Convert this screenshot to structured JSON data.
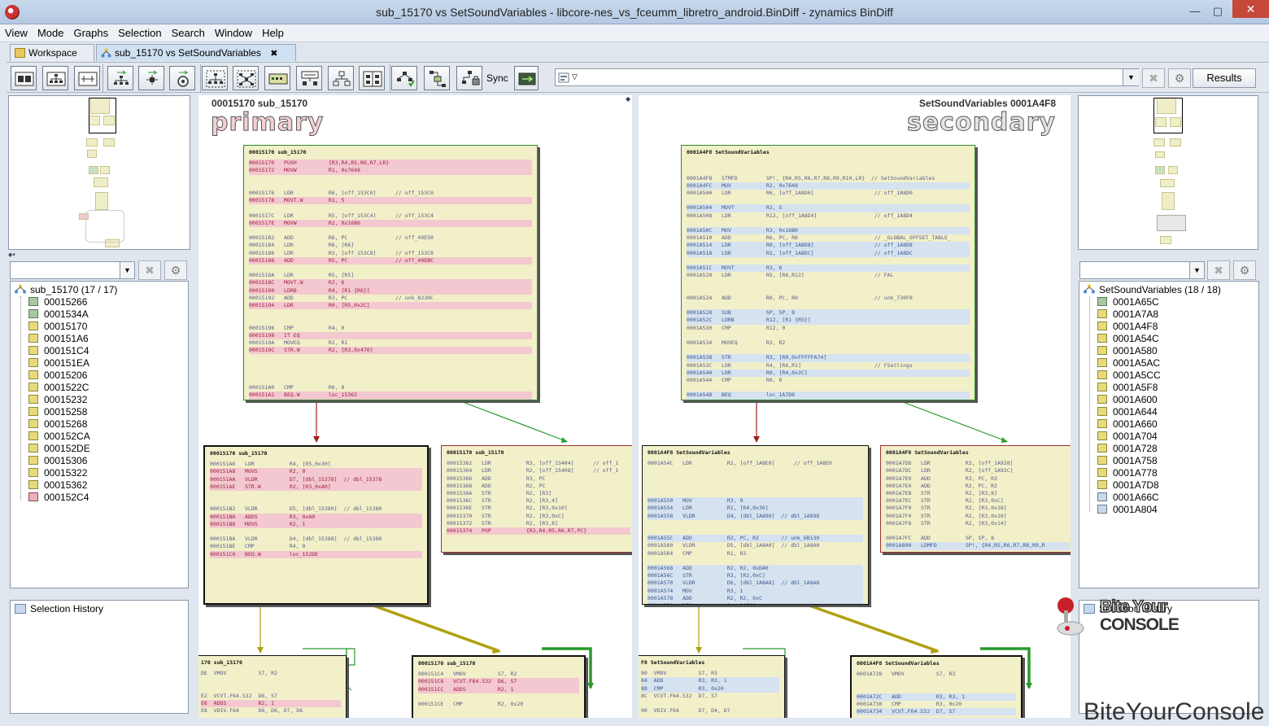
{
  "window": {
    "title": "sub_15170 vs SetSoundVariables - libcore-nes_vs_fceumm_libretro_android.BinDiff - zynamics BinDiff",
    "minimize": "—",
    "maximize": "▢",
    "close": "✕"
  },
  "menu": [
    "View",
    "Mode",
    "Graphs",
    "Selection",
    "Search",
    "Window",
    "Help"
  ],
  "tabs": [
    {
      "label": "Workspace"
    },
    {
      "label": "sub_15170 vs SetSoundVariables",
      "close": "✖"
    }
  ],
  "toolbar": {
    "sync_label": "Sync",
    "results_label": "Results"
  },
  "primary": {
    "header": "00015170  sub_15170",
    "label": "primary",
    "tree_root": "sub_15170 (17 / 17)",
    "tree_items": [
      {
        "addr": "00015266",
        "kind": "g"
      },
      {
        "addr": "0001534A",
        "kind": "g"
      },
      {
        "addr": "00015170",
        "kind": "y"
      },
      {
        "addr": "000151A6",
        "kind": "y"
      },
      {
        "addr": "000151C4",
        "kind": "y"
      },
      {
        "addr": "000151EA",
        "kind": "y"
      },
      {
        "addr": "00015206",
        "kind": "y"
      },
      {
        "addr": "0001522C",
        "kind": "y"
      },
      {
        "addr": "00015232",
        "kind": "y"
      },
      {
        "addr": "00015258",
        "kind": "y"
      },
      {
        "addr": "00015268",
        "kind": "y"
      },
      {
        "addr": "000152CA",
        "kind": "y"
      },
      {
        "addr": "000152DE",
        "kind": "y"
      },
      {
        "addr": "00015306",
        "kind": "y"
      },
      {
        "addr": "00015322",
        "kind": "y"
      },
      {
        "addr": "00015362",
        "kind": "y"
      },
      {
        "addr": "000152C4",
        "kind": "r"
      }
    ],
    "history_title": "Selection History"
  },
  "secondary": {
    "header": "SetSoundVariables  0001A4F8",
    "label": "secondary",
    "tree_root": "SetSoundVariables (18 / 18)",
    "tree_items": [
      {
        "addr": "0001A65C",
        "kind": "g"
      },
      {
        "addr": "0001A7A8",
        "kind": "y"
      },
      {
        "addr": "0001A4F8",
        "kind": "y"
      },
      {
        "addr": "0001A54C",
        "kind": "y"
      },
      {
        "addr": "0001A580",
        "kind": "y"
      },
      {
        "addr": "0001A5AC",
        "kind": "y"
      },
      {
        "addr": "0001A5CC",
        "kind": "y"
      },
      {
        "addr": "0001A5F8",
        "kind": "y"
      },
      {
        "addr": "0001A600",
        "kind": "y"
      },
      {
        "addr": "0001A644",
        "kind": "y"
      },
      {
        "addr": "0001A660",
        "kind": "y"
      },
      {
        "addr": "0001A704",
        "kind": "y"
      },
      {
        "addr": "0001A728",
        "kind": "y"
      },
      {
        "addr": "0001A758",
        "kind": "y"
      },
      {
        "addr": "0001A778",
        "kind": "y"
      },
      {
        "addr": "0001A7D8",
        "kind": "y"
      },
      {
        "addr": "0001A66C",
        "kind": "b"
      },
      {
        "addr": "0001A804",
        "kind": "b"
      }
    ],
    "history_title": "Selection History"
  },
  "blocks": {
    "p1": {
      "head": "00015170    sub_15170",
      "lines": [
        [
          "pk",
          "00015170   PUSH          {R3,R4,R5,R6,R7,LR}"
        ],
        [
          "pk",
          "00015172   MOVW          R1, 0x7648"
        ],
        [
          "",
          ""
        ],
        [
          "",
          ""
        ],
        [
          "",
          "00015176   LDR           R6, [off_153C0]      // off_153C0"
        ],
        [
          "pk",
          "00015178   MOVT.W        R1, 5"
        ],
        [
          "",
          ""
        ],
        [
          "",
          "0001517C   LDR           R5, [off_153C4]      // off_153C4"
        ],
        [
          "pk",
          "0001517E   MOVW          R2, 0x16B0"
        ],
        [
          "",
          ""
        ],
        [
          "",
          "00015182   ADD           R6, PC               // off_49E50"
        ],
        [
          "",
          "00015184   LDR           R6, [R6]"
        ],
        [
          "",
          "00015186   LDR           R3, [off_153C8]      // off_153C8"
        ],
        [
          "pk",
          "00015188   ADD           R5, PC               // off_49EBC"
        ],
        [
          "",
          ""
        ],
        [
          "",
          "0001518A   LDR           R5, [R5]"
        ],
        [
          "pk",
          "0001518C   MOVT.W        R2, 6"
        ],
        [
          "pk",
          "00015190   LDRB          R4, [R1 {R6}]"
        ],
        [
          "",
          "00015192   ADD           R3, PC               // unk_8230C"
        ],
        [
          "pk",
          "00015194   LDR           R0, [R5,0x2C]"
        ],
        [
          "",
          ""
        ],
        [
          "",
          ""
        ],
        [
          "",
          "00015196   CMP           R4, 0"
        ],
        [
          "pk",
          "00015198   IT EQ"
        ],
        [
          "",
          "0001519A   MOVEQ         R2, R1"
        ],
        [
          "pk",
          "0001519C   STR.W         R2, [R3,0x470]"
        ],
        [
          "",
          ""
        ],
        [
          "",
          ""
        ],
        [
          "",
          ""
        ],
        [
          "",
          ""
        ],
        [
          "",
          "000151A0   CMP           R0, 0"
        ],
        [
          "pk",
          "000151A2   BEQ.W         loc_15362"
        ]
      ]
    },
    "p2": {
      "head": "00015170    sub_15170",
      "lines": [
        [
          "",
          "000151A6   LDR           R4, [R5,0x30]"
        ],
        [
          "pk",
          "000151A8   MOVS          R2, 0"
        ],
        [
          "pk",
          "000151AA   VLDR          D7, [dbl_15378]  // dbl_15378"
        ],
        [
          "pk",
          "000151AE   STR.W         R2, [R3,0xA0]"
        ],
        [
          "",
          ""
        ],
        [
          "",
          ""
        ],
        [
          "",
          "000151B2   VLDR          D5, [dbl_15380]  // dbl_15380"
        ],
        [
          "pk",
          "000151B6   ADDS          R3, 0xA0"
        ],
        [
          "pk",
          "000151B8   MOVS          R2, 1"
        ],
        [
          "",
          ""
        ],
        [
          "",
          "000151BA   VLDR          D4, [dbl_15388]  // dbl_15388"
        ],
        [
          "",
          "000151BE   CMP           R4, 0"
        ],
        [
          "pk",
          "000151C0   BEQ.W         loc_152DE"
        ]
      ]
    },
    "p3": {
      "head": "00015170    sub_15170",
      "lines": [
        [
          "",
          "00015362   LDR           R3, [off_15404]      // off_1"
        ],
        [
          "",
          "00015364   LDR           R2, [off_15408]      // off_1"
        ],
        [
          "",
          "00015366   ADD           R3, PC"
        ],
        [
          "",
          "00015368   ADD           R2, PC"
        ],
        [
          "",
          "0001536A   STR           R2, [R3]"
        ],
        [
          "",
          "0001536C   STR           R2, [R3,4]"
        ],
        [
          "",
          "0001536E   STR           R2, [R3,0x10]"
        ],
        [
          "",
          "00015370   STR           R2, [R3,0xC]"
        ],
        [
          "",
          "00015372   STR           R2, [R3,8]"
        ],
        [
          "pk",
          "00015374   POP           {R3,R4,R5,R6,R7,PC}"
        ]
      ]
    },
    "p4": {
      "head": "170    sub_15170",
      "lines": [
        [
          "",
          "DE  VMOV          S7, R2"
        ],
        [
          "",
          ""
        ],
        [
          "",
          ""
        ],
        [
          "",
          "E2  VCVT.F64.S32  D6, S7"
        ],
        [
          "pk",
          "E6  ADDS          R2, 1"
        ],
        [
          "",
          "E8  VDIV.F64      D6, D6, D7, D6"
        ]
      ]
    },
    "p5": {
      "head": "00015170    sub_15170",
      "lines": [
        [
          "",
          "000151C4   VMOV          S7, R2"
        ],
        [
          "pk",
          "000151C8   VCVT.F64.S32  D6, S7"
        ],
        [
          "pk",
          "000151CC   ADDS          R2, 1"
        ],
        [
          "",
          ""
        ],
        [
          "",
          "000151CE   CMP           R2, 0x20"
        ]
      ]
    },
    "s1": {
      "head": "0001A4F8    SetSoundVariables",
      "lines": [
        [
          "",
          ""
        ],
        [
          "",
          ""
        ],
        [
          "",
          "0001A4F8   STMFD         SP!, {R4,R5,R6,R7,R8,R9,R10,LR}  // SetSoundVariables"
        ],
        [
          "bl",
          "0001A4FC   MOV           R2, 0x7648"
        ],
        [
          "",
          "0001A500   LDR           R6, [off_1A8D0]                   // off_1A8D0"
        ],
        [
          "",
          ""
        ],
        [
          "bl",
          "0001A504   MOVT          R2, 5"
        ],
        [
          "",
          "0001A508   LDR           R12, [off_1A8D4]                  // off_1A8D4"
        ],
        [
          "",
          ""
        ],
        [
          "bl",
          "0001A50C   MOV           R3, 0x16B0"
        ],
        [
          "",
          "0001A510   ADD           R6, PC, R6                        // _GLOBAL_OFFSET_TABLE_"
        ],
        [
          "bl",
          "0001A514   LDR           R0, [off_1A8D8]                   // off_1A8D8"
        ],
        [
          "bl",
          "0001A518   LDR           R1, [off_1A8DC]                   // off_1A8DC"
        ],
        [
          "",
          ""
        ],
        [
          "bl",
          "0001A51C   MOVT          R3, 6"
        ],
        [
          "",
          "0001A520   LDR           R5, [R6,R12]                      // FAL"
        ],
        [
          "",
          ""
        ],
        [
          "",
          ""
        ],
        [
          "",
          "0001A524   ADD           R0, PC, R0                        // unk_730F0"
        ],
        [
          "",
          ""
        ],
        [
          "bl",
          "0001A528   SUB           SP, SP, 8"
        ],
        [
          "bl",
          "0001A52C   LDRB          R12, [R1 {R5}]"
        ],
        [
          "",
          "0001A530   CMP           R12, 0"
        ],
        [
          "",
          ""
        ],
        [
          "",
          "0001A534   MOVEQ         R3, R2"
        ],
        [
          "",
          ""
        ],
        [
          "bl",
          "0001A538   STR           R3, [R0,0xFFFFFA74]"
        ],
        [
          "",
          "0001A53C   LDR           R4, [R6,R1]                       // FSettings"
        ],
        [
          "bl",
          "0001A540   LDR           R0, [R4,0x2C]"
        ],
        [
          "",
          "0001A544   CMP           R0, 0"
        ],
        [
          "",
          ""
        ],
        [
          "bl",
          "0001A548   BEQ           loc_1A7D8"
        ]
      ]
    },
    "s2": {
      "head": "0001A4F8    SetSoundVariables",
      "lines": [
        [
          "",
          "0001A54C   LDR           R2, [off_1A8E0]      // off_1A8E0"
        ],
        [
          "",
          ""
        ],
        [
          "",
          ""
        ],
        [
          "",
          ""
        ],
        [
          "",
          ""
        ],
        [
          "bl",
          "0001A550   MOV           R3, 0"
        ],
        [
          "bl",
          "0001A554   LDR           R1, [R4,0x30]"
        ],
        [
          "bl",
          "0001A558   VLDR          D4, [dbl_1A898]  // dbl_1A898"
        ],
        [
          "",
          ""
        ],
        [
          "",
          ""
        ],
        [
          "bl",
          "0001A55C   ADD           R2, PC, R2       // unk_6B130"
        ],
        [
          "",
          "0001A560   VLDR          D5, [dbl_1A8A0]  // dbl_1A8A0"
        ],
        [
          "",
          "0001A564   CMP           R1, R3"
        ],
        [
          "",
          ""
        ],
        [
          "bl",
          "0001A568   ADD           R2, R2, 0xDA0"
        ],
        [
          "bl",
          "0001A56C   STR           R3, [R2,0xC]"
        ],
        [
          "bl",
          "0001A570   VLDR          D6, [dbl_1A8A8]  // dbl_1A8A8"
        ],
        [
          "bl",
          "0001A574   MOV           R3, 1"
        ],
        [
          "bl",
          "0001A578   ADD           R2, R2, 0xC"
        ],
        [
          "bl",
          "0001A57C   BEQ           loc_1A728"
        ]
      ]
    },
    "s3": {
      "head": "0001A4F8    SetSoundVariables",
      "lines": [
        [
          "",
          "0001A7D8   LDR           R3, [off_1A928]"
        ],
        [
          "",
          "0001A7DC   LDR           R2, [off_1A92C]"
        ],
        [
          "",
          "0001A7E0   ADD           R3, PC, R3"
        ],
        [
          "",
          "0001A7E4   ADD           R2, PC, R2"
        ],
        [
          "",
          "0001A7E8   STR           R2, [R3,8]"
        ],
        [
          "",
          "0001A7EC   STR           R2, [R3,0xC]"
        ],
        [
          "",
          "0001A7F0   STR           R2, [R3,0x18]"
        ],
        [
          "",
          "0001A7F4   STR           R2, [R3,0x10]"
        ],
        [
          "",
          "0001A7F8   STR           R2, [R3,0x14]"
        ],
        [
          "",
          ""
        ],
        [
          "",
          "0001A7FC   ADD           SP, SP, 8"
        ],
        [
          "bl",
          "0001A800   LDMFD         SP!, {R4,R5,R6,R7,R8,R9,R"
        ]
      ]
    },
    "s4": {
      "head": "F8    SetSoundVariables",
      "lines": [
        [
          "",
          "80  VMOV          S7, R3"
        ],
        [
          "bl",
          "84  ADD           R3, R3, 1"
        ],
        [
          "bl",
          "88  CMP           R3, 0x20"
        ],
        [
          "",
          "8C  VCVT.F64.S32  D7, S7"
        ],
        [
          "",
          ""
        ],
        [
          "",
          "90  VDIV.F64      D7, D4, D7"
        ]
      ]
    },
    "s5": {
      "head": "0001A4F8    SetSoundVariables",
      "lines": [
        [
          "",
          "0001A728   VMOV          S7, R3"
        ],
        [
          "",
          ""
        ],
        [
          "",
          ""
        ],
        [
          "bl",
          "0001A72C   ADD           R3, R3, 1"
        ],
        [
          "",
          "0001A730   CMP           R3, 0x20"
        ],
        [
          "bl",
          "0001A734   VCVT.F64.S32  D7, S7"
        ]
      ]
    }
  },
  "logo": {
    "line1": "Bite Your",
    "line2": "CONSOLE"
  },
  "watermark": "BiteYourConsole",
  "colors": {
    "match_edge": "#2a9a2a",
    "unmatched_edge": "#a02020",
    "changed_edge": "#b0a010",
    "block_fill": "#f2f0c8"
  }
}
